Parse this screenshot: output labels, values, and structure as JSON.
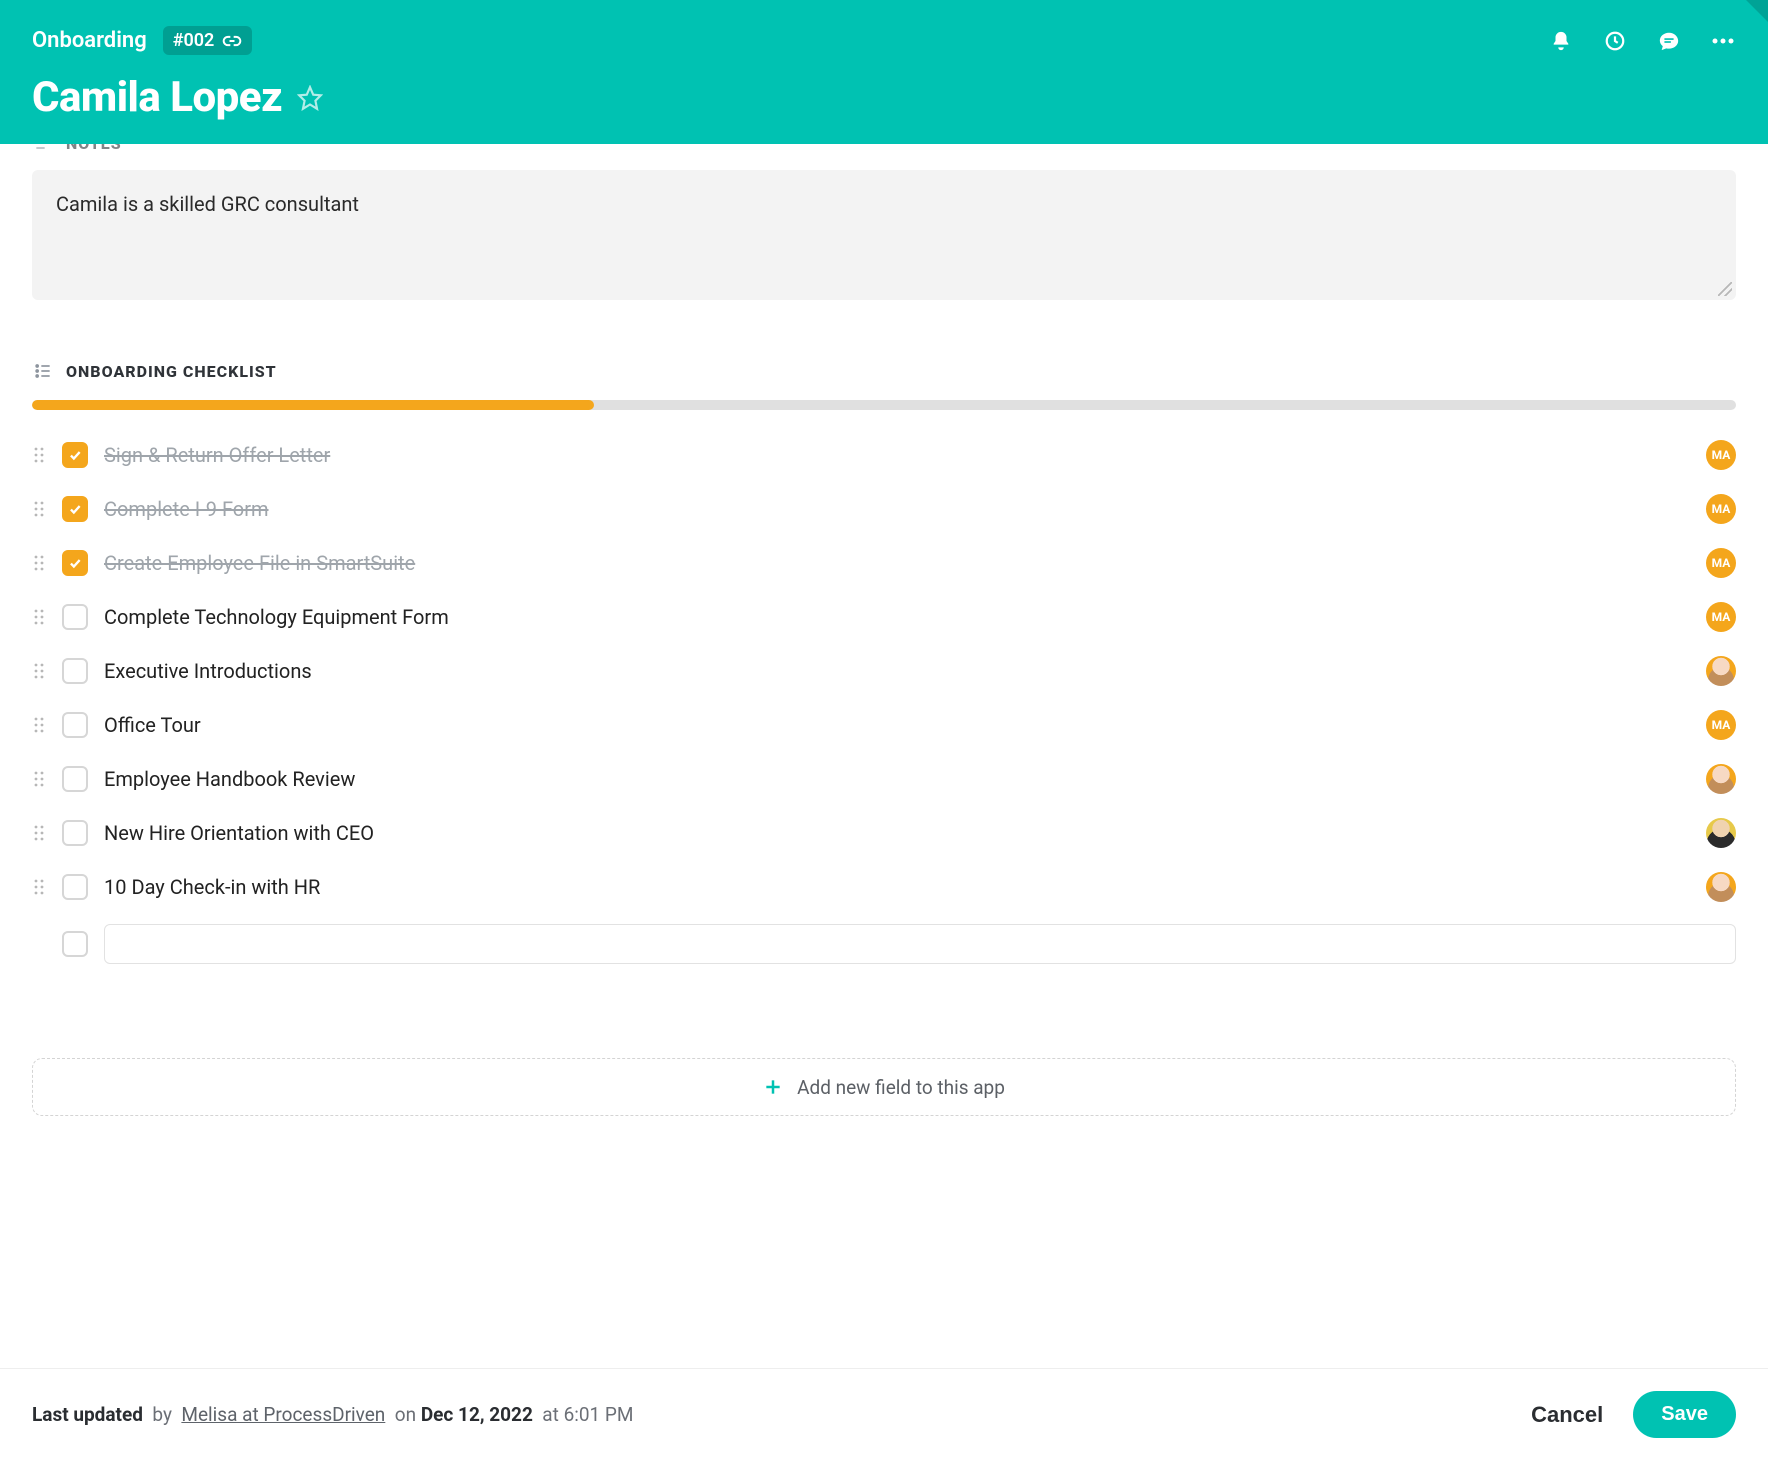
{
  "header": {
    "breadcrumb": "Onboarding",
    "record_id": "#002",
    "title": "Camila Lopez"
  },
  "notes": {
    "section_label": "NOTES",
    "text": "Camila is a skilled GRC consultant"
  },
  "checklist": {
    "section_label": "ONBOARDING CHECKLIST",
    "progress_percent": 33,
    "items": [
      {
        "label": "Sign & Return Offer Letter",
        "done": true,
        "assignee": {
          "type": "initials",
          "text": "MA"
        }
      },
      {
        "label": "Complete I-9 Form",
        "done": true,
        "assignee": {
          "type": "initials",
          "text": "MA"
        }
      },
      {
        "label": "Create Employee File in SmartSuite",
        "done": true,
        "assignee": {
          "type": "initials",
          "text": "MA"
        }
      },
      {
        "label": "Complete Technology Equipment Form",
        "done": false,
        "assignee": {
          "type": "initials",
          "text": "MA"
        }
      },
      {
        "label": "Executive Introductions",
        "done": false,
        "assignee": {
          "type": "photo1"
        }
      },
      {
        "label": "Office Tour",
        "done": false,
        "assignee": {
          "type": "initials",
          "text": "MA"
        }
      },
      {
        "label": "Employee Handbook Review",
        "done": false,
        "assignee": {
          "type": "photo1"
        }
      },
      {
        "label": "New Hire Orientation with CEO",
        "done": false,
        "assignee": {
          "type": "photo2"
        }
      },
      {
        "label": "10 Day Check-in with HR",
        "done": false,
        "assignee": {
          "type": "photo1"
        }
      }
    ],
    "new_item_placeholder": ""
  },
  "add_field": {
    "label": "Add new field to this app"
  },
  "footer": {
    "last_updated_label": "Last updated",
    "by_label": "by",
    "by_name": "Melisa at ProcessDriven",
    "on_label": "on",
    "date": "Dec 12, 2022",
    "at_label": "at",
    "time": "6:01 PM",
    "cancel": "Cancel",
    "save": "Save"
  }
}
